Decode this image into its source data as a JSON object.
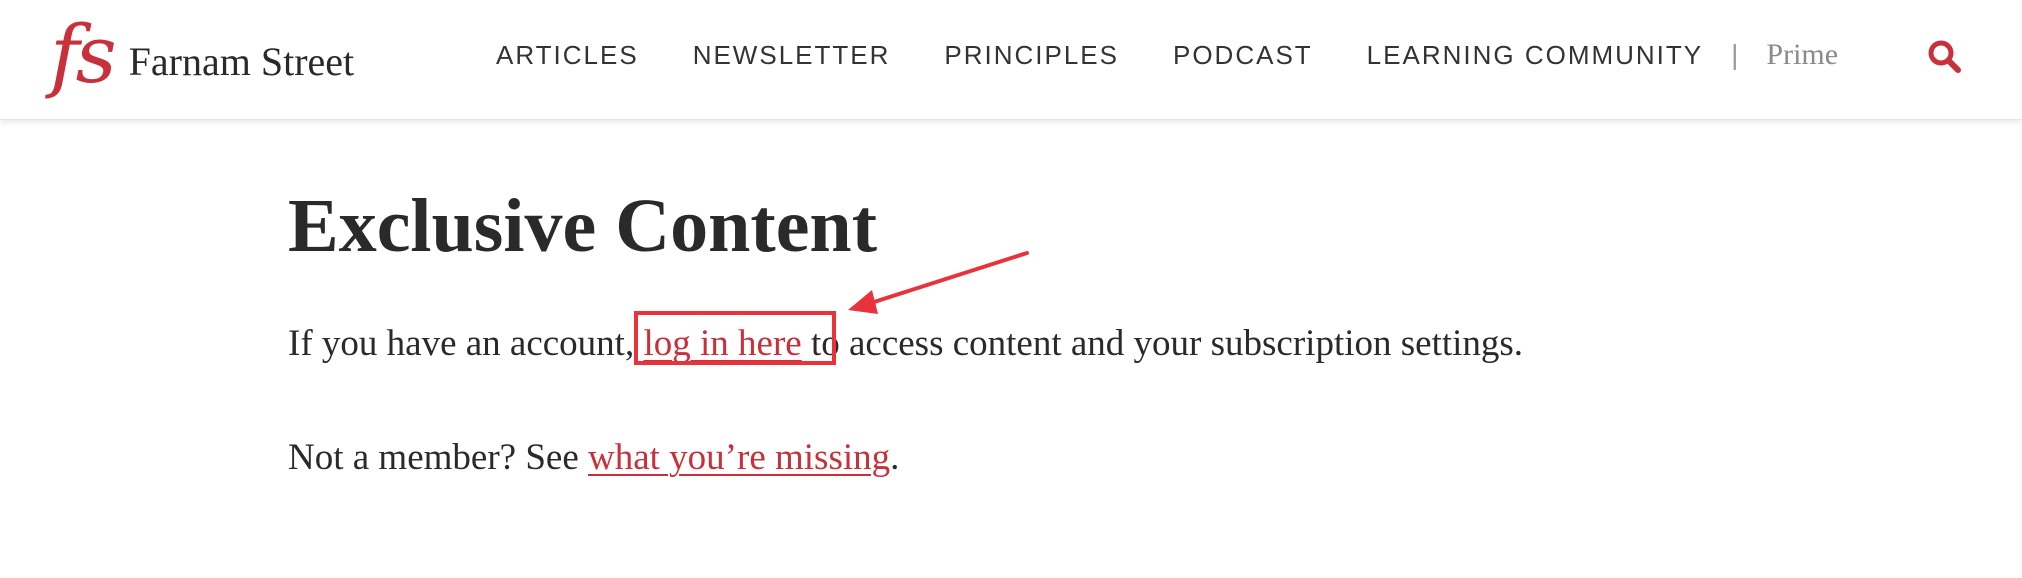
{
  "header": {
    "logo_mark": "fs",
    "logo_text": "Farnam Street",
    "nav": [
      {
        "label": "ARTICLES"
      },
      {
        "label": "NEWSLETTER"
      },
      {
        "label": "PRINCIPLES"
      },
      {
        "label": "PODCAST"
      },
      {
        "label": "LEARNING COMMUNITY"
      }
    ],
    "divider": "|",
    "prime_label": "Prime",
    "search_icon": "search-icon"
  },
  "main": {
    "title": "Exclusive Content",
    "para1": {
      "before": "If you have an account, ",
      "link": "log in here",
      "after": " to access content and your subscription settings."
    },
    "para2": {
      "before": "Not a member? See ",
      "link": "what you’re missing",
      "after": "."
    }
  },
  "colors": {
    "brand_red": "#c8303a",
    "annotation_red": "#e8333a",
    "text": "#2a2a2a"
  }
}
